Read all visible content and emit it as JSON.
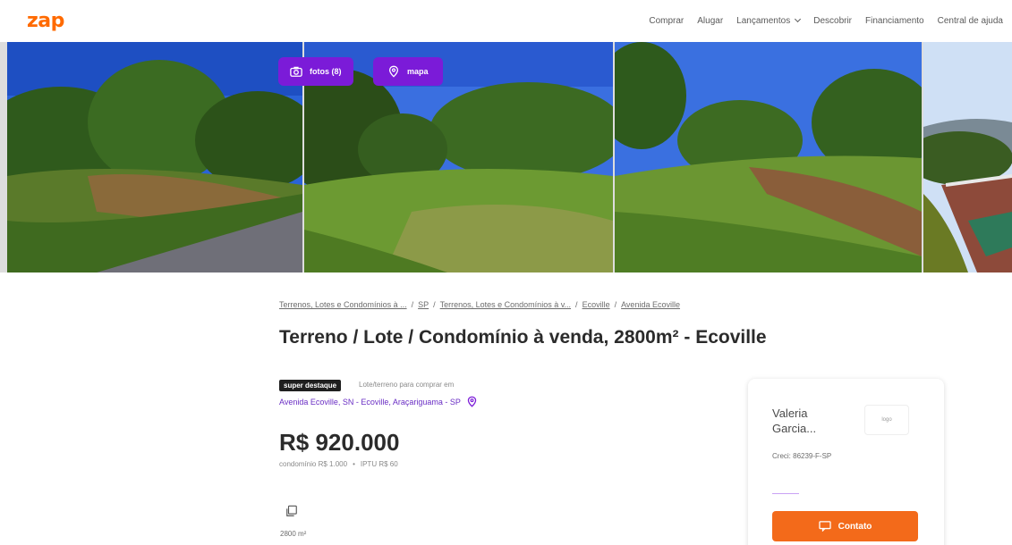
{
  "header": {
    "logo": "zap",
    "nav": [
      {
        "label": "Comprar"
      },
      {
        "label": "Alugar"
      },
      {
        "label": "Lançamentos",
        "has_dropdown": true
      },
      {
        "label": "Descobrir"
      },
      {
        "label": "Financiamento"
      },
      {
        "label": "Central de ajuda"
      }
    ]
  },
  "gallery": {
    "photos_button": "fotos (8)",
    "map_button": "mapa",
    "photo_icon": "camera-icon",
    "map_icon": "map-pin-icon"
  },
  "breadcrumb": [
    "Terrenos, Lotes e Condomínios à ...",
    "SP",
    "Terrenos, Lotes e Condomínios à v...",
    "Ecoville",
    "Avenida Ecoville"
  ],
  "listing": {
    "title": "Terreno / Lote / Condomínio à venda, 2800m² - Ecoville",
    "badge": "super destaque",
    "badge_note": "Lote/terreno para comprar em",
    "address": "Avenida Ecoville, SN - Ecoville, Araçariguama - SP",
    "price": "R$ 920.000",
    "condo_fee": "condomínio R$ 1.000",
    "iptu": "IPTU R$ 60",
    "area": "2800 m²"
  },
  "contact_card": {
    "agent_name": "Valeria Garcia...",
    "agent_logo_text": "logo",
    "creci": "Creci: 86239-F-SP",
    "contact_button": "Contato"
  },
  "colors": {
    "brand_orange": "#ff6a00",
    "accent_purple": "#7b1bd8",
    "button_orange": "#f36a1a"
  }
}
